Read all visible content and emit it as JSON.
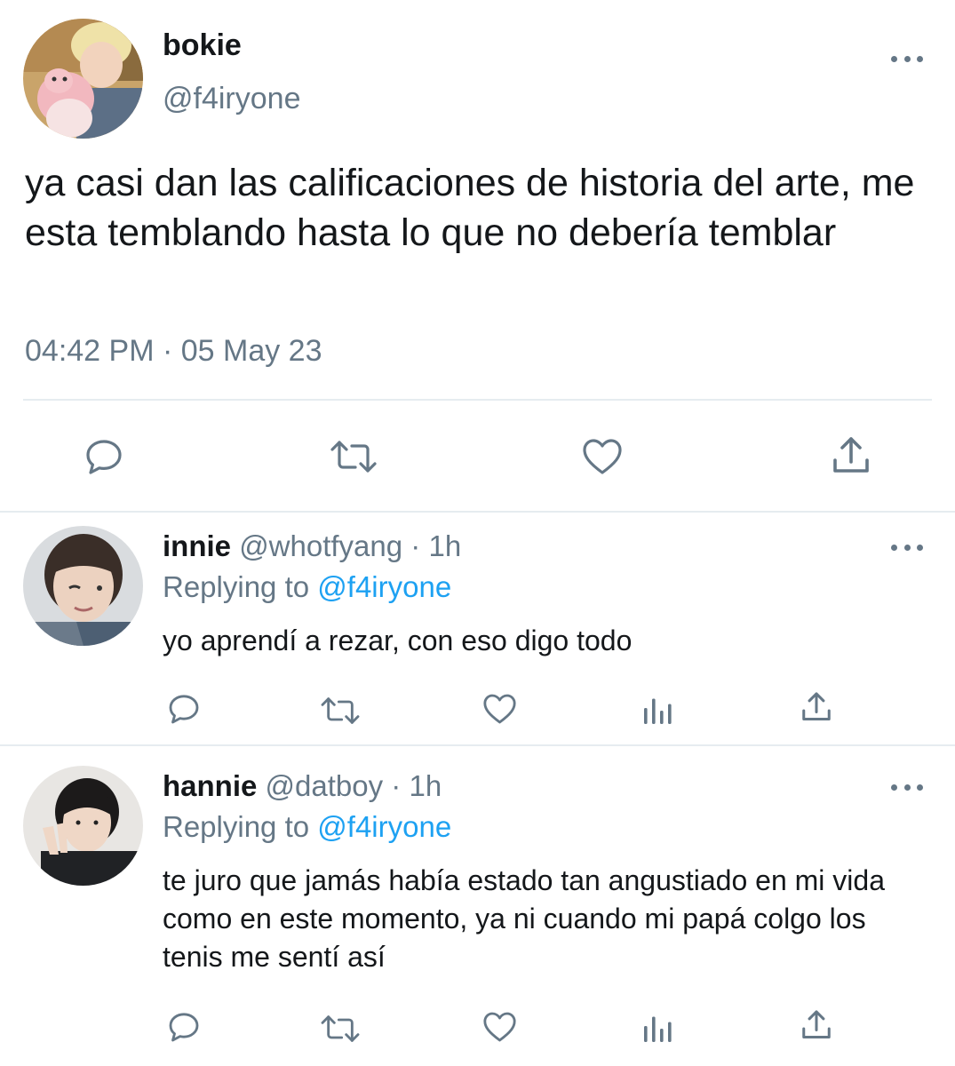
{
  "tweet": {
    "display_name": "bokie",
    "handle": "@f4iryone",
    "text": "ya casi dan las calificaciones de historia del arte, me esta temblando hasta lo que no debería temblar",
    "timestamp": "04:42 PM · 05 May 23",
    "actions": [
      "reply-icon",
      "retweet-icon",
      "like-icon",
      "share-icon"
    ]
  },
  "replies": [
    {
      "display_name": "innie",
      "handle": "@whotfyang",
      "separator": "·",
      "time": "1h",
      "replying_prefix": "Replying to",
      "replying_handle": "@f4iryone",
      "text": "yo aprendí a rezar, con eso digo todo",
      "actions": [
        "reply-icon",
        "retweet-icon",
        "like-icon",
        "analytics-icon",
        "share-icon"
      ]
    },
    {
      "display_name": "hannie",
      "handle": "@datboy",
      "separator": "·",
      "time": "1h",
      "replying_prefix": "Replying to",
      "replying_handle": "@f4iryone",
      "text": "te juro que jamás había estado tan angustiado en mi vida como en este momento, ya ni cuando mi papá colgo los tenis me sentí así",
      "actions": [
        "reply-icon",
        "retweet-icon",
        "like-icon",
        "analytics-icon",
        "share-icon"
      ]
    }
  ],
  "colors": {
    "text": "#14171a",
    "muted": "#657786",
    "link": "#1da1f2",
    "divider": "#e6ecf0"
  }
}
